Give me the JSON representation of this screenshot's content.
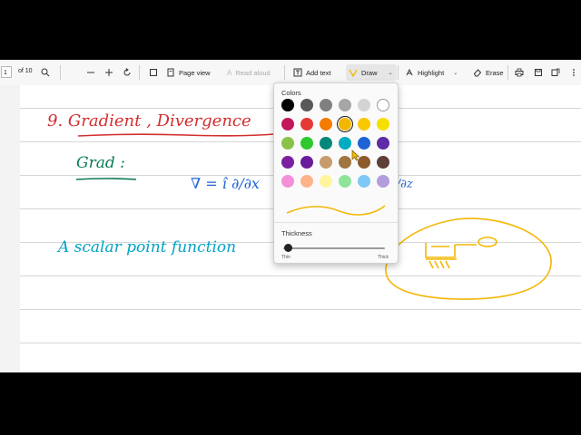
{
  "toolbar": {
    "page_current": "1",
    "page_of": "of 10",
    "page_view_label": "Page view",
    "read_aloud_label": "Read aloud",
    "add_text_label": "Add text",
    "draw_label": "Draw",
    "highlight_label": "Highlight",
    "erase_label": "Erase",
    "icons": [
      "search-icon",
      "zoom-out-icon",
      "zoom-in-icon",
      "rotate-icon",
      "page-view-icon",
      "read-aloud-icon",
      "add-text-icon",
      "draw-icon",
      "chevron-down-icon",
      "highlight-icon",
      "erase-icon",
      "print-icon",
      "save-icon",
      "save-as-icon",
      "more-icon"
    ]
  },
  "flyout": {
    "colors_title": "Colors",
    "thickness_title": "Thickness",
    "thin_label": "Thin",
    "thick_label": "Thick",
    "thickness_value": 0.05,
    "preview_color": "#f2b705",
    "selected_swatch": "orange",
    "swatches": [
      [
        "#000000",
        "#595959",
        "#808080",
        "#a6a6a6",
        "#d3d3d3",
        "#ffffff"
      ],
      [
        "#c2185b",
        "#e53935",
        "#f57c00",
        "#f2b705",
        "#f9c800",
        "#f5e000"
      ],
      [
        "#8bc34a",
        "#2ec92e",
        "#00897b",
        "#00acc1",
        "#1e63d6",
        "#5e2ca5"
      ],
      [
        "#7b1fa2",
        "#6a1b9a",
        "#c69c6d",
        "#a0753f",
        "#8d5a2b",
        "#5d4037"
      ],
      [
        "#f48fd8",
        "#ffb38a",
        "#fff59d",
        "#8ee59a",
        "#7ec8f7",
        "#b39ddb"
      ]
    ]
  },
  "document": {
    "heading": "9.  Gradient , Divergence",
    "heading_color": "#d32f2f",
    "subheading": "Grad :",
    "subheading_color": "#0b7a55",
    "formula_left": "∇ = î ∂/∂x",
    "formula_right": "∂/∂z",
    "formula_color": "#1e63d6",
    "body_line": "A  scalar  point  function",
    "body_color": "#00a3c4",
    "annotation_color": "#f2b705"
  }
}
